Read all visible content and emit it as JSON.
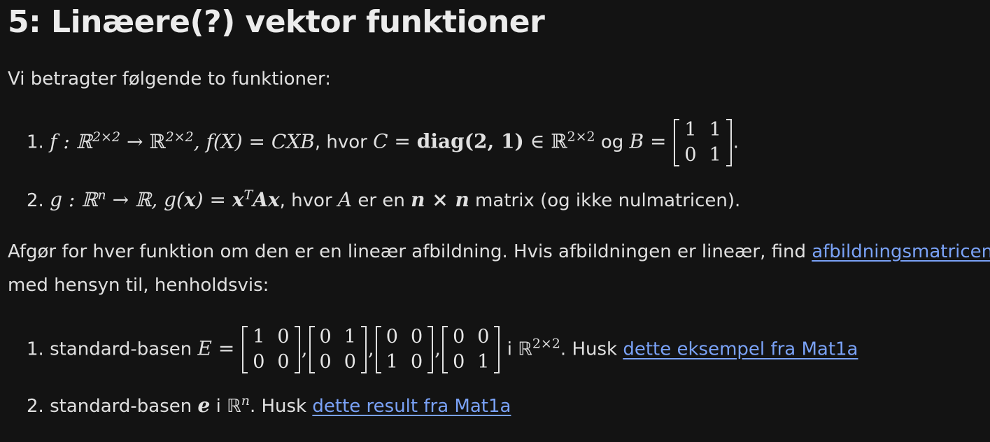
{
  "title": "5: Linæere(?) vektor funktioner",
  "intro": "Vi betragter følgende to funktioner:",
  "functions": [
    {
      "num": "1.",
      "f_lhs": "f : ℝ",
      "dims": "2×2",
      "arrow": " → ℝ",
      "comma_fx": ", f(X) = CXB",
      "hvor": ", hvor ",
      "C_def": "C = ",
      "diag": "diag(2, 1)",
      "in_R": " ∈ ℝ",
      "og": " og ",
      "B_def": "B = ",
      "B_matrix": [
        [
          "1",
          "1"
        ],
        [
          "0",
          "1"
        ]
      ],
      "end": "."
    },
    {
      "num": "2.",
      "g_lhs": "g : ℝ",
      "n_sup": "n",
      "arrow": " → ℝ, g(",
      "x": "x",
      "eq": ") = ",
      "xT": "x",
      "T": "T",
      "Ax": "Ax",
      "hvor": ", hvor ",
      "A": "A",
      "er_en": " er en ",
      "nxn": "n × n",
      "rest": " matrix (og ikke nulmatricen)."
    }
  ],
  "question_line1_pre": "Afgør for hver funktion om den er en lineær afbildning. Hvis afbildningen er lineær, find ",
  "question_link": "afbildningsmatricen",
  "question_line2": "med hensyn til, henholdsvis:",
  "bases": [
    {
      "num": "1.",
      "pre": " standard-basen ",
      "E": "E",
      "eq": " = ",
      "matrices": [
        [
          [
            "1",
            "0"
          ],
          [
            "0",
            "0"
          ]
        ],
        [
          [
            "0",
            "1"
          ],
          [
            "0",
            "0"
          ]
        ],
        [
          [
            "0",
            "0"
          ],
          [
            "1",
            "0"
          ]
        ],
        [
          [
            "0",
            "0"
          ],
          [
            "0",
            "1"
          ]
        ]
      ],
      "sep": ",",
      "i_R": " i ℝ",
      "dims": "2×2",
      "husk": ". Husk ",
      "link": "dette eksempel fra Mat1a"
    },
    {
      "num": "2.",
      "pre": " standard-basen ",
      "e": "e",
      "i_R": " i ℝ",
      "n_sup": "n",
      "husk": ". Husk ",
      "link": "dette result fra Mat1a"
    }
  ]
}
